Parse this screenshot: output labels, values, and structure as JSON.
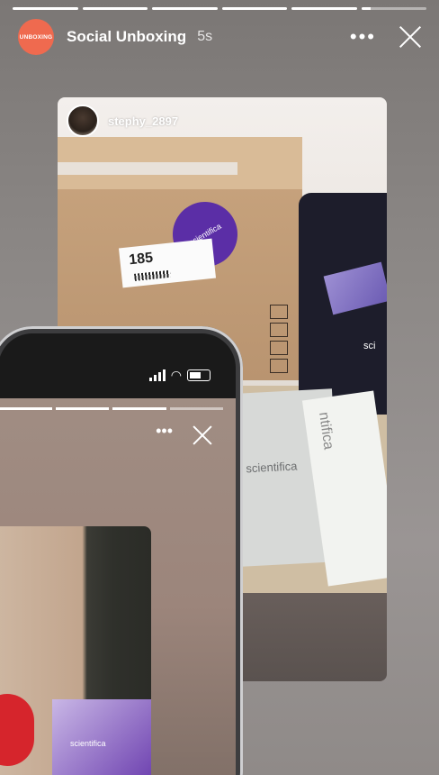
{
  "story": {
    "progress": [
      1,
      1,
      1,
      1,
      1,
      0.15
    ],
    "avatar_text": "UNBOXING",
    "account": "Social Unboxing",
    "time": "5s",
    "more_glyph": "•••",
    "colors": {
      "avatar_bg": "#ef6a4f",
      "text": "#ffffff"
    }
  },
  "repost": {
    "username": "stephy_2897",
    "box_label_number": "185",
    "sticker_text": "scientifica",
    "bag_text": "sci",
    "booklet_text": "scientifica",
    "paper_text": "ntifica"
  },
  "phone": {
    "status_icons": [
      "signal-icon",
      "wifi-icon",
      "battery-icon"
    ],
    "inner_story": {
      "progress": [
        1,
        1,
        1,
        0.5
      ],
      "more_glyph": "•••",
      "pack_text": "scientifica"
    }
  }
}
